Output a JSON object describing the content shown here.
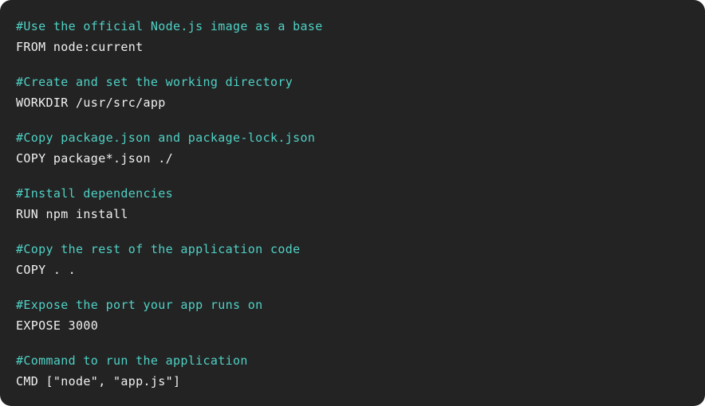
{
  "code": {
    "blocks": [
      {
        "comment": "#Use the official Node.js image as a base",
        "instruction": "FROM node:current"
      },
      {
        "comment": "#Create and set the working directory",
        "instruction": "WORKDIR /usr/src/app"
      },
      {
        "comment": "#Copy package.json and package-lock.json",
        "instruction": "COPY package*.json ./"
      },
      {
        "comment": "#Install dependencies",
        "instruction": "RUN npm install"
      },
      {
        "comment": "#Copy the rest of the application code",
        "instruction": "COPY . ."
      },
      {
        "comment": "#Expose the port your app runs on",
        "instruction": "EXPOSE 3000"
      },
      {
        "comment": "#Command to run the application",
        "instruction": "CMD [\"node\", \"app.js\"]"
      }
    ]
  },
  "colors": {
    "background": "#232323",
    "comment": "#4fd1c5",
    "instruction": "#f0f0f0"
  }
}
